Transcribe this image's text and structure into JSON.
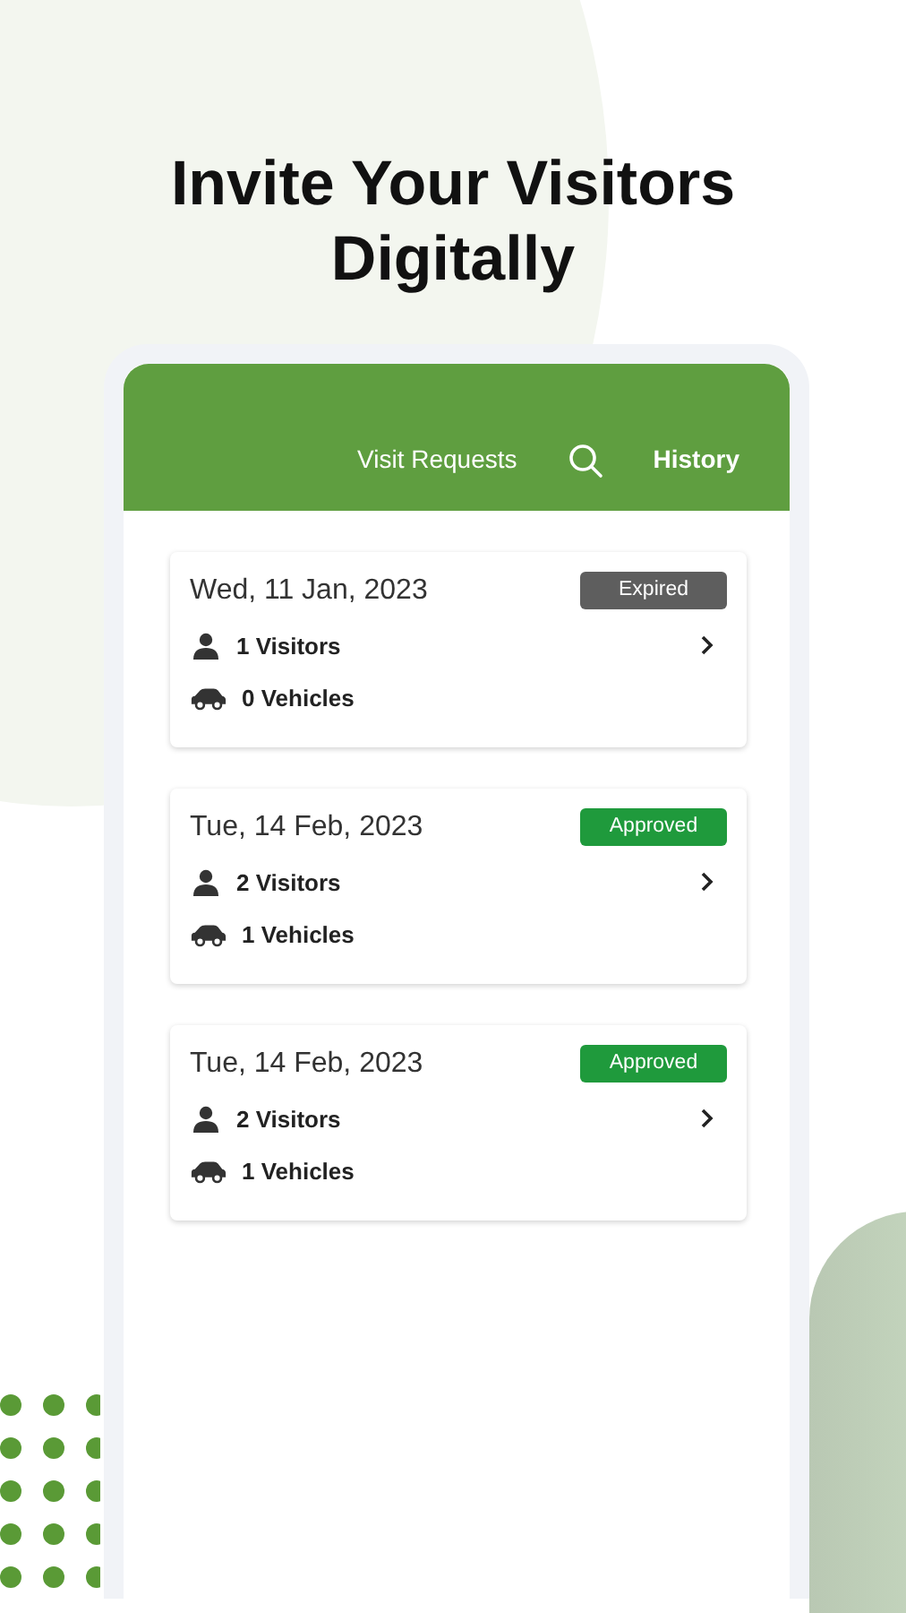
{
  "headline": "Invite Your Visitors Digitally",
  "app_bar": {
    "tabs": [
      {
        "label": "Visit Requests",
        "selected": false
      },
      {
        "label": "History",
        "selected": true
      }
    ]
  },
  "visits": [
    {
      "date": "Wed, 11 Jan, 2023",
      "status": "Expired",
      "color": "#5e5e5e",
      "visitors": "1 Visitors",
      "vehicles": "0 Vehicles"
    },
    {
      "date": "Tue, 14 Feb, 2023",
      "status": "Approved",
      "color": "#1f9a3c",
      "visitors": "2 Visitors",
      "vehicles": "1 Vehicles"
    },
    {
      "date": "Tue, 14 Feb, 2023",
      "status": "Approved",
      "color": "#1f9a3c",
      "visitors": "2 Visitors",
      "vehicles": "1 Vehicles"
    }
  ]
}
